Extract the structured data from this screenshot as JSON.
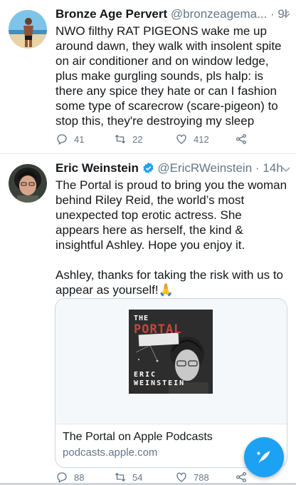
{
  "tweets": [
    {
      "name": "Bronze Age Pervert",
      "handle": "@bronzeagema...",
      "separator": "·",
      "time": "9h",
      "text": "NWO filthy RAT PIGEONS wake me up around dawn, they walk with insolent spite on air conditioner and on window ledge, plus make gurgling sounds, pls halp: is there any spice they hate or can I fashion some type of scarecrow (scare-pigeon) to stop this, they're destroying my sleep",
      "replies": "41",
      "retweets": "22",
      "likes": "412"
    },
    {
      "name": "Eric Weinstein",
      "handle": "@EricRWeinstein",
      "separator": "·",
      "time": "14h",
      "verified": true,
      "text": "The Portal is proud to bring you the woman behind Riley Reid, the world’s most unexpected top erotic actress. She appears here as herself, the kind & insightful Ashley. Hope you enjoy it.\n\nAshley, thanks for taking the risk with us to appear as yourself!🙏",
      "card": {
        "cover_top": "THE",
        "cover_title": "PORTAL",
        "cover_bottom_1": "ERIC",
        "cover_bottom_2": "WEINSTEIN",
        "title": "The Portal on Apple Podcasts",
        "domain": "podcasts.apple.com"
      },
      "replies": "88",
      "retweets": "54",
      "likes": "788"
    }
  ],
  "colors": {
    "accent": "#1da1f2",
    "text": "#14171a",
    "muted": "#657786",
    "border": "#e1e8ed"
  },
  "icons": [
    "reply-icon",
    "retweet-icon",
    "like-icon",
    "share-icon",
    "verified-icon",
    "compose-icon",
    "chevron-down-icon"
  ]
}
